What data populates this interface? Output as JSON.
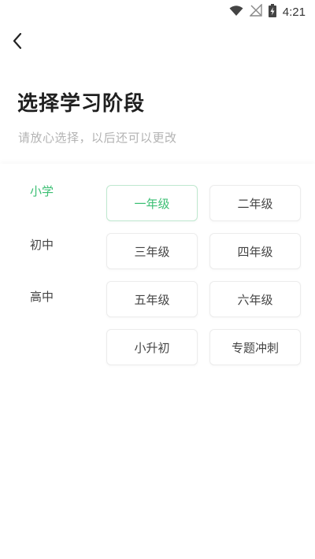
{
  "status_bar": {
    "time": "4:21",
    "icons": [
      "wifi-icon",
      "no-signal-icon",
      "battery-charging-icon"
    ]
  },
  "header": {
    "back_icon": "chevron-left-icon",
    "title": "选择学习阶段",
    "subtitle": "请放心选择，以后还可以更改"
  },
  "colors": {
    "accent": "#3bbf73",
    "selected_border": "#bfe8cf"
  },
  "stages": [
    {
      "label": "小学",
      "active": true
    },
    {
      "label": "初中",
      "active": false
    },
    {
      "label": "高中",
      "active": false
    }
  ],
  "grades": [
    {
      "label": "一年级",
      "selected": true
    },
    {
      "label": "二年级",
      "selected": false
    },
    {
      "label": "三年级",
      "selected": false
    },
    {
      "label": "四年级",
      "selected": false
    },
    {
      "label": "五年级",
      "selected": false
    },
    {
      "label": "六年级",
      "selected": false
    },
    {
      "label": "小升初",
      "selected": false
    },
    {
      "label": "专题冲刺",
      "selected": false
    }
  ]
}
